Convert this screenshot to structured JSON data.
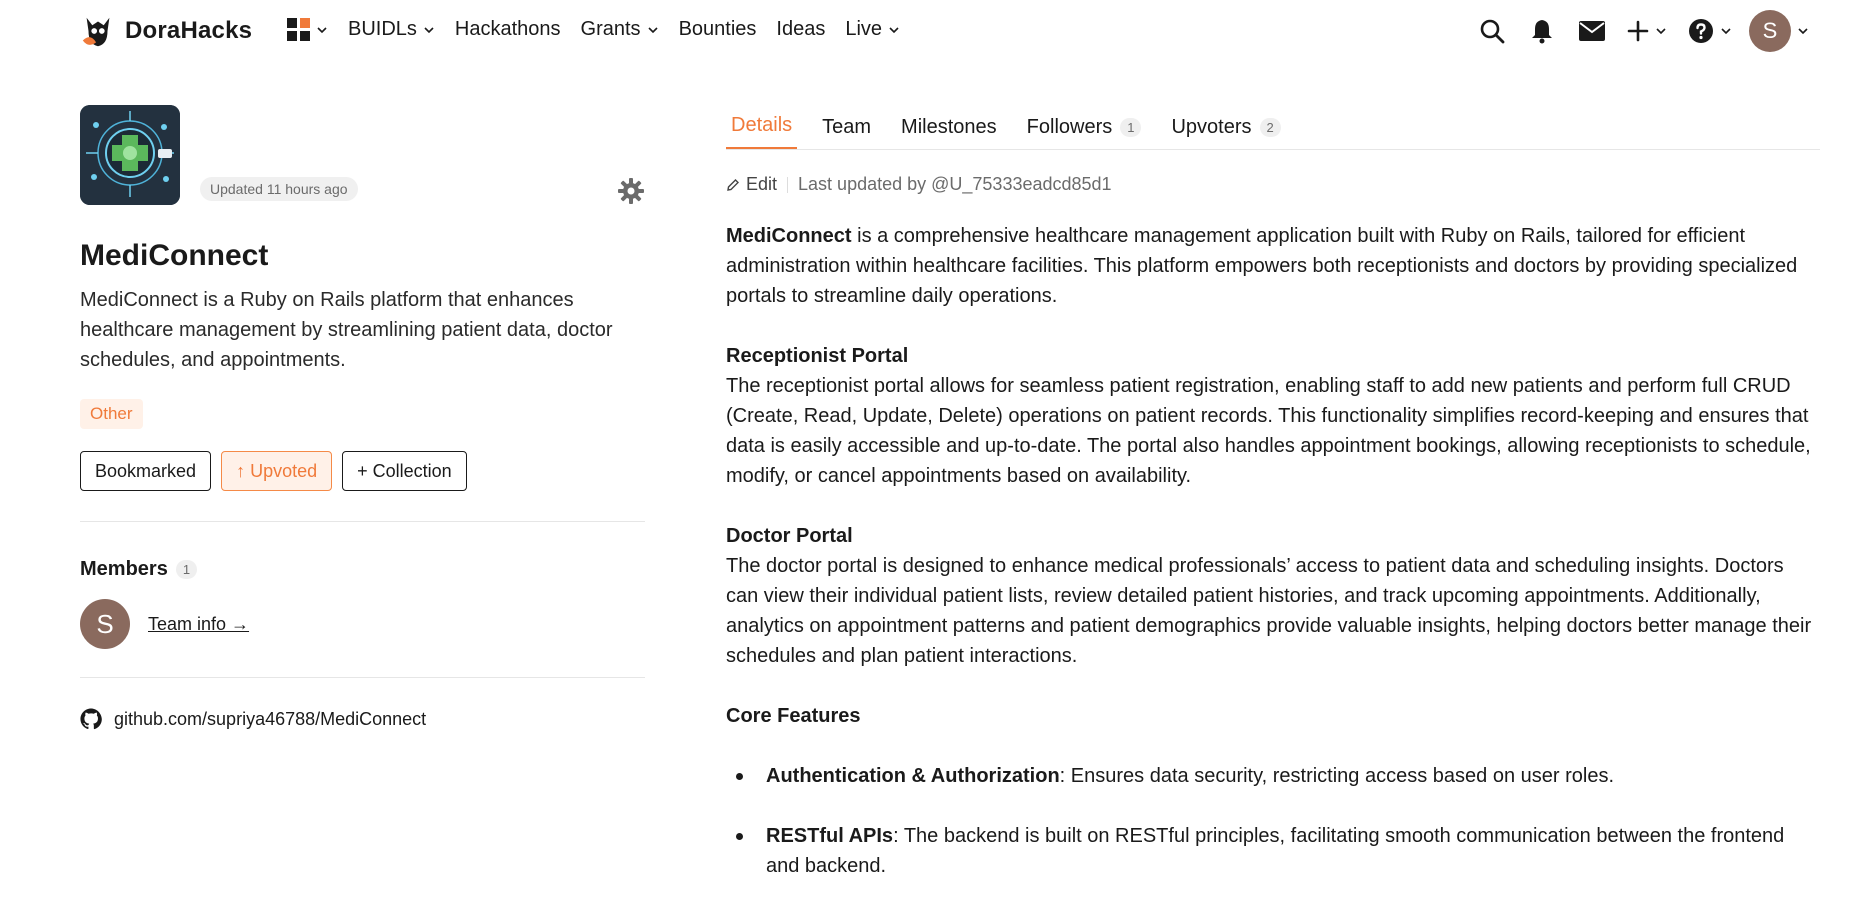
{
  "brand": {
    "name": "DoraHacks",
    "accent": "#f07a3a"
  },
  "nav": {
    "apps_icon": "apps-grid-icon",
    "items": [
      {
        "label": "BUIDLs",
        "has_dropdown": true
      },
      {
        "label": "Hackathons",
        "has_dropdown": false
      },
      {
        "label": "Grants",
        "has_dropdown": true
      },
      {
        "label": "Bounties",
        "has_dropdown": false
      },
      {
        "label": "Ideas",
        "has_dropdown": false
      },
      {
        "label": "Live",
        "has_dropdown": true
      }
    ],
    "right_icons": [
      "search-icon",
      "bell-icon",
      "mail-icon",
      "plus-icon",
      "help-icon"
    ],
    "user_initial": "S"
  },
  "project": {
    "updated": "Updated 11 hours ago",
    "title": "MediConnect",
    "description": "MediConnect is a Ruby on Rails platform that enhances healthcare management by streamlining patient data, doctor schedules, and appointments.",
    "tag": "Other",
    "buttons": {
      "bookmark": "Bookmarked",
      "upvote": "↑ Upvoted",
      "collection": "+ Collection"
    },
    "members": {
      "heading": "Members",
      "count": "1",
      "member_initial": "S",
      "team_link": "Team info →"
    },
    "repo": "github.com/supriya46788/MediConnect"
  },
  "tabs": [
    {
      "label": "Details",
      "count": "",
      "active": true
    },
    {
      "label": "Team",
      "count": ""
    },
    {
      "label": "Milestones",
      "count": ""
    },
    {
      "label": "Followers",
      "count": "1"
    },
    {
      "label": "Upvoters",
      "count": "2"
    }
  ],
  "edit": {
    "label": "Edit",
    "last_updated": "Last updated by @U_75333eadcd85d1"
  },
  "details": {
    "intro_bold": "MediConnect",
    "intro_rest": " is a comprehensive healthcare management application built with Ruby on Rails, tailored for efficient administration within healthcare facilities. This platform empowers both receptionists and doctors by providing specialized portals to streamline daily operations.",
    "receptionist_heading": "Receptionist Portal",
    "receptionist_text": "The receptionist portal allows for seamless patient registration, enabling staff to add new patients and perform full CRUD (Create, Read, Update, Delete) operations on patient records. This functionality simplifies record-keeping and ensures that data is easily accessible and up-to-date. The portal also handles appointment bookings, allowing receptionists to schedule, modify, or cancel appointments based on availability.",
    "doctor_heading": "Doctor Portal",
    "doctor_text": "The doctor portal is designed to enhance medical professionals’ access to patient data and scheduling insights. Doctors can view their individual patient lists, review detailed patient histories, and track upcoming appointments. Additionally, analytics on appointment patterns and patient demographics provide valuable insights, helping doctors better manage their schedules and plan patient interactions.",
    "core_heading": "Core Features",
    "features": [
      {
        "title": "Authentication & Authorization",
        "text": ": Ensures data security, restricting access based on user roles."
      },
      {
        "title": "RESTful APIs",
        "text": ": The backend is built on RESTful principles, facilitating smooth communication between the frontend and backend."
      }
    ]
  }
}
